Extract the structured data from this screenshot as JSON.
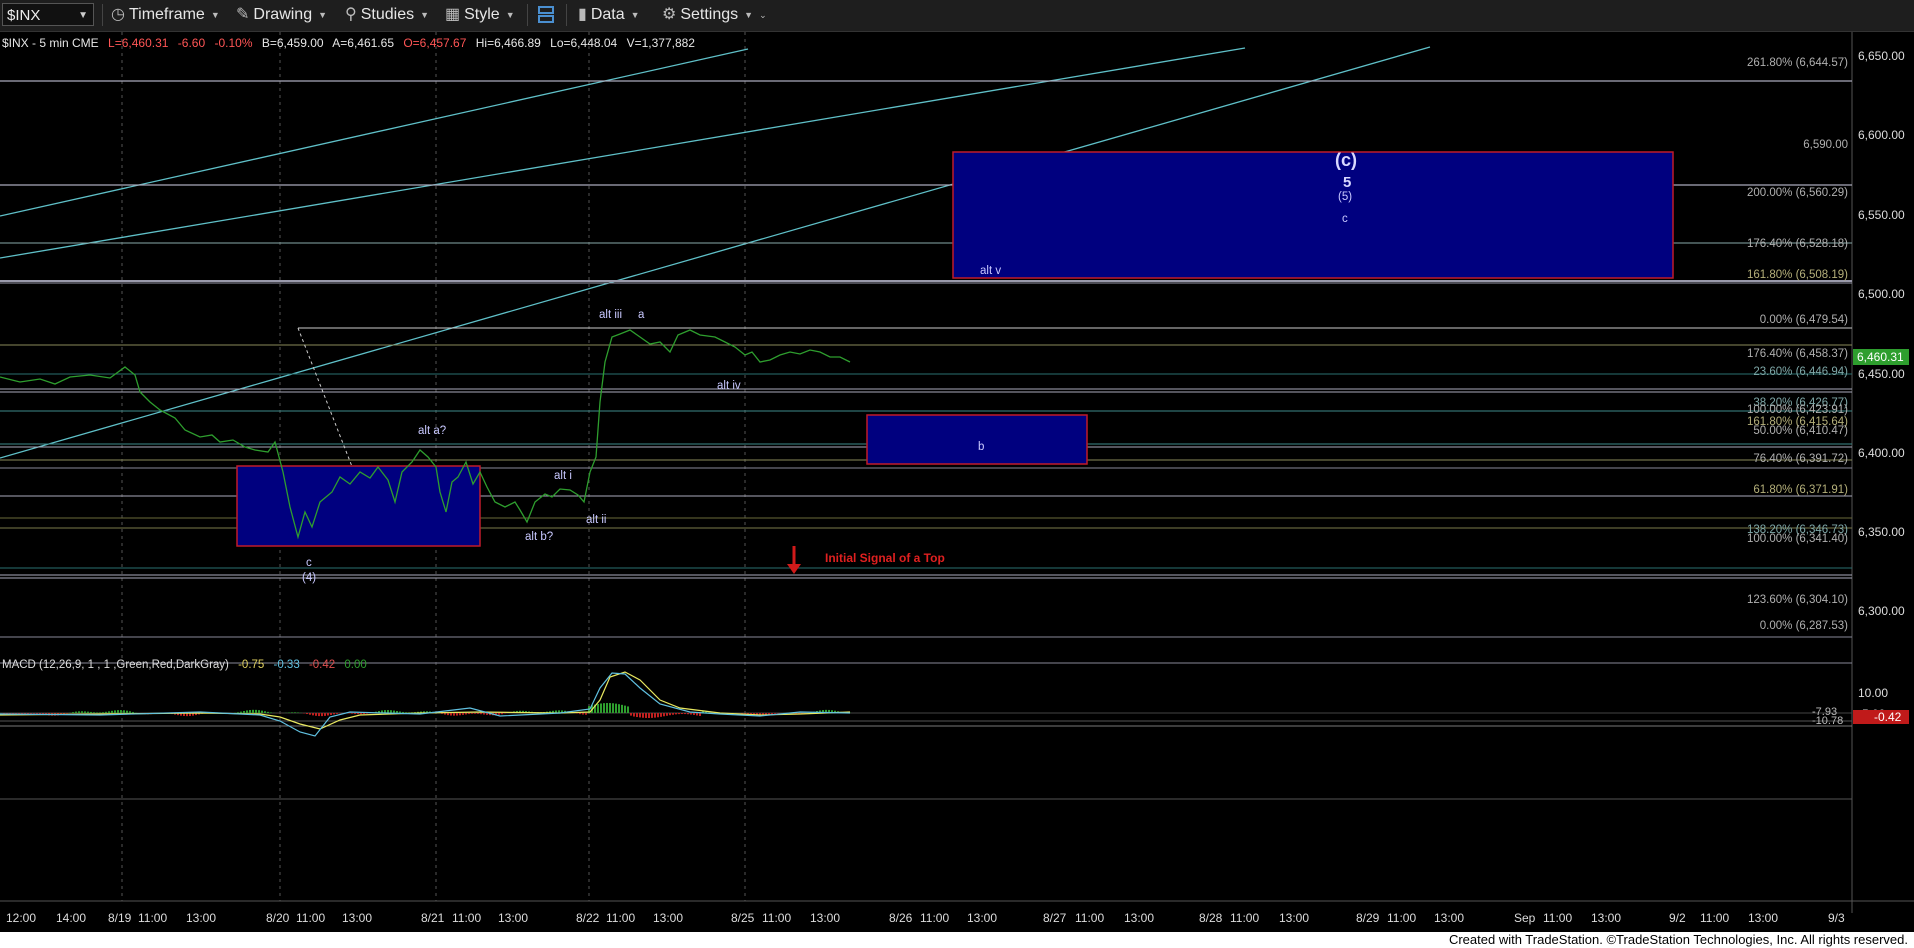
{
  "toolbar": {
    "symbol": "$INX",
    "timeframe": "Timeframe",
    "drawing": "Drawing",
    "studies": "Studies",
    "style": "Style",
    "data": "Data",
    "settings": "Settings"
  },
  "chart_header": {
    "symbol_tf": "$INX - 5 min  CME",
    "last": "L=6,460.31",
    "change": "-6.60",
    "change_pct": "-0.10%",
    "bid": "B=6,459.00",
    "ask": "A=6,461.65",
    "open": "O=6,457.67",
    "high": "Hi=6,466.89",
    "low": "Lo=6,448.04",
    "volume": "V=1,377,882"
  },
  "price_axis": [
    "6,650.00",
    "6,600.00",
    "6,550.00",
    "6,500.00",
    "6,450.00",
    "6,400.00",
    "6,350.00",
    "6,300.00"
  ],
  "last_price_tag": "6,460.31",
  "fib_labels": [
    {
      "text": "261.80% (6,644.57)",
      "price": 6644.57,
      "color": "#b0b0b0"
    },
    {
      "text": "6,590.00",
      "price": 6590.0,
      "color": "#b0b0b0"
    },
    {
      "text": "200.00% (6,560.29)",
      "price": 6560.29,
      "color": "#b0b0b0"
    },
    {
      "text": "176.40% (6,528.18)",
      "price": 6528.18,
      "color": "#b0b0b0"
    },
    {
      "text": "161.80% (6,508.19)",
      "price": 6508.19,
      "color": "#b5b07a"
    },
    {
      "text": "0.00% (6,479.54)",
      "price": 6479.54,
      "color": "#b0b0b0"
    },
    {
      "text": "176.40% (6,458.37)",
      "price": 6458.37,
      "color": "#b0b0b0"
    },
    {
      "text": "23.60% (6,446.94)",
      "price": 6446.94,
      "color": "#7fa8a8"
    },
    {
      "text": "38.20% (6,426.77)",
      "price": 6426.77,
      "color": "#7fa8a8"
    },
    {
      "text": "100.00% (6,423.91)",
      "price": 6423.91,
      "color": "#b0b0b0"
    },
    {
      "text": "161.80% (6,415.64)",
      "price": 6415.64,
      "color": "#b5b07a"
    },
    {
      "text": "50.00% (6,410.47)",
      "price": 6410.47,
      "color": "#b0b0b0"
    },
    {
      "text": "76.40% (6,391.72)",
      "price": 6391.72,
      "color": "#b0b0b0"
    },
    {
      "text": "61.80% (6,371.91)",
      "price": 6371.91,
      "color": "#b5b07a"
    },
    {
      "text": "138.20% (6,346.73)",
      "price": 6346.73,
      "color": "#7fa8a8"
    },
    {
      "text": "100.00% (6,341.40)",
      "price": 6341.4,
      "color": "#b0b0b0"
    },
    {
      "text": "123.60% (6,304.10)",
      "price": 6304.1,
      "color": "#b0b0b0"
    },
    {
      "text": "0.00% (6,287.53)",
      "price": 6287.53,
      "color": "#b0b0b0"
    }
  ],
  "wave_labels": {
    "c_big": "(c)",
    "five": "5",
    "five_paren": "(5)",
    "c_small": "c",
    "alt_v": "alt v",
    "alt_iii": "alt iii",
    "a": "a",
    "alt_iv": "alt iv",
    "b": "b",
    "alt_a": "alt a?",
    "alt_i": "alt i",
    "alt_ii": "alt ii",
    "alt_b": "alt b?",
    "c_low": "c",
    "four": "(4)",
    "signal": "Initial Signal of a Top"
  },
  "macd": {
    "label": "MACD (12,26,9, 1 , 1 ,Green,Red,DarkGray)",
    "v1": "-0.75",
    "v2": "-0.33",
    "v3": "-0.42",
    "v4": "0.00",
    "axis_top": "10.00",
    "axis_bottom": "-5.00",
    "tag1": "-7.93",
    "tag2": "-10.78",
    "tag_hist": "-0.42"
  },
  "time_axis": [
    "12:00",
    "14:00",
    "8/19",
    "11:00",
    "13:00",
    "8/20",
    "11:00",
    "13:00",
    "8/21",
    "11:00",
    "13:00",
    "8/22",
    "11:00",
    "13:00",
    "8/25",
    "11:00",
    "13:00",
    "8/26",
    "11:00",
    "13:00",
    "8/27",
    "11:00",
    "13:00",
    "8/28",
    "11:00",
    "13:00",
    "8/29",
    "11:00",
    "13:00",
    "Sep",
    "11:00",
    "13:00",
    "9/2",
    "11:00",
    "13:00",
    "9/3"
  ],
  "footer": "Created with TradeStation. ©TradeStation Technologies, Inc. All rights reserved.",
  "colors": {
    "price_line": "#2e9e2e",
    "box_fill": "#000080",
    "box_border": "#c01a2a",
    "trendline": "#5fc0c8",
    "signal": "#d11a1a"
  }
}
